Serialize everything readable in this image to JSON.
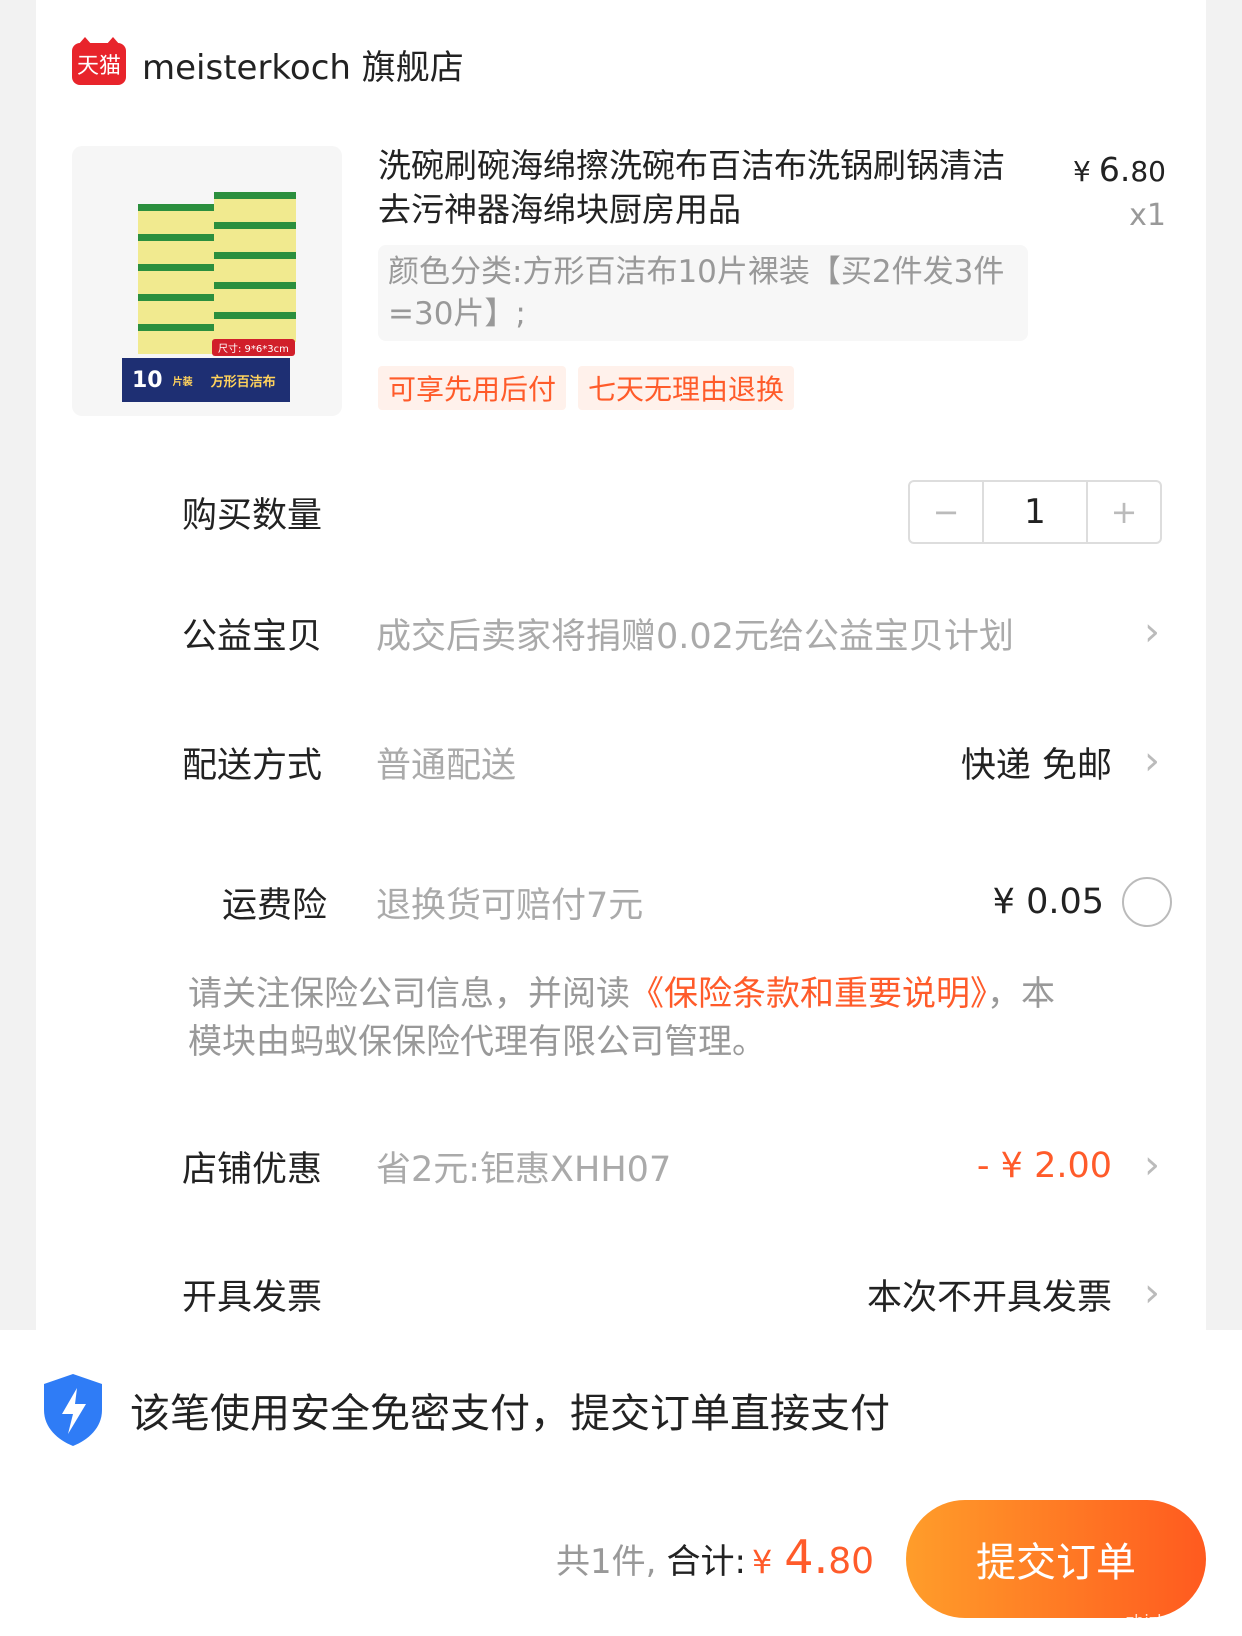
{
  "store": {
    "badge": "天猫",
    "name": "meisterkoch 旗舰店"
  },
  "product": {
    "title": "洗碗刷碗海绵擦洗碗布百洁布洗锅刷锅清洁去污神器海绵块厨房用品",
    "price_currency": "¥",
    "price_int": "6.",
    "price_dec": "80",
    "quantity_tag": "x1",
    "sku": "颜色分类:方形百洁布10片裸装【买2件发3件=30片】;",
    "tags": [
      "可享先用后付",
      "七天无理由退换"
    ],
    "image": {
      "count_text": "10",
      "count_unit": "片装",
      "pack_label": "方形百洁布",
      "size_label": "尺寸: 9*6*3cm"
    }
  },
  "quantity": {
    "label": "购买数量",
    "value": "1",
    "minus": "−",
    "plus": "+"
  },
  "charity": {
    "label": "公益宝贝",
    "desc": "成交后卖家将捐赠0.02元给公益宝贝计划"
  },
  "shipping": {
    "label": "配送方式",
    "desc": "普通配送",
    "value": "快递 免邮"
  },
  "insurance": {
    "label": "运费险",
    "desc": "退换货可赔付7元",
    "value": "¥ 0.05",
    "notice_before": "请关注保险公司信息，并阅读",
    "notice_link": "《保险条款和重要说明》",
    "notice_after": "，本模块由蚂蚁保保险代理有限公司管理。"
  },
  "discount": {
    "label": "店铺优惠",
    "desc": "省2元:钜惠XHH07",
    "value": "- ¥ 2.00"
  },
  "invoice": {
    "label": "开具发票",
    "value": "本次不开具发票"
  },
  "pay_tip": "该笔使用安全免密支付，提交订单直接支付",
  "footer": {
    "count_text": "共1件,",
    "total_label": "合计:",
    "currency": "¥",
    "total_int": "4.",
    "total_dec": "80",
    "submit": "提交订单"
  },
  "watermark": "zhizhizhi.com",
  "colors": {
    "accent": "#ff5b2a",
    "tmall_red": "#e8242b",
    "shield_blue": "#2f7cf6"
  }
}
